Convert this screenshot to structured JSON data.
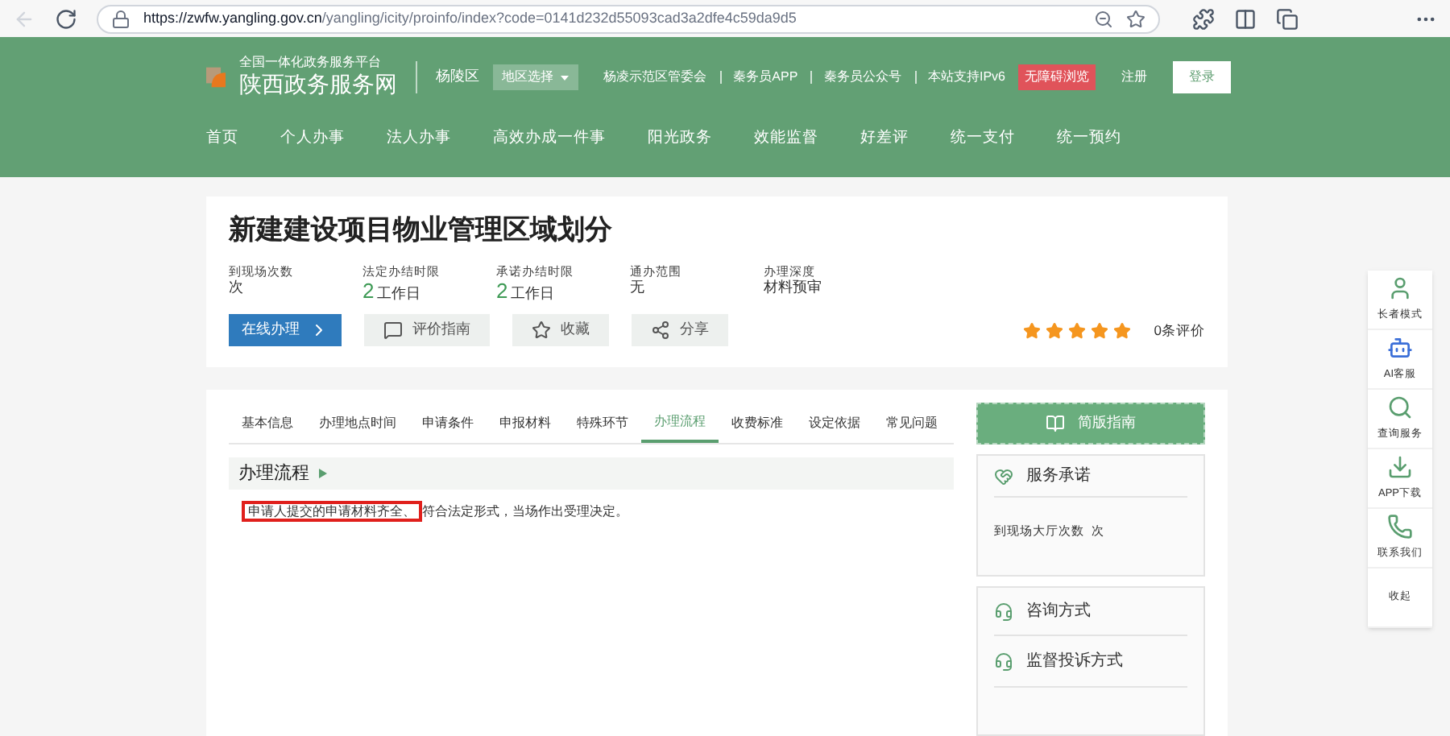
{
  "browser": {
    "url_host": "https://zwfw.yangling.gov.cn",
    "url_path": "/yangling/icity/proinfo/index?code=0141d232d55093cad3a2dfe4c59da9d5"
  },
  "header": {
    "logo_sub": "全国一体化政务服务平台",
    "logo_title": "陕西政务服务网",
    "region": "杨陵区",
    "region_select": "地区选择",
    "top_links": [
      "杨凌示范区管委会",
      "秦务员APP",
      "秦务员公众号",
      "本站支持IPv6"
    ],
    "accessibility": "无障碍浏览",
    "register": "注册",
    "login": "登录",
    "nav": [
      "首页",
      "个人办事",
      "法人办事",
      "高效办成一件事",
      "阳光政务",
      "效能监督",
      "好差评",
      "统一支付",
      "统一预约"
    ]
  },
  "service": {
    "title": "新建建设项目物业管理区域划分",
    "facts": [
      {
        "label": "到现场次数",
        "value": "次"
      },
      {
        "label": "法定办结时限",
        "number": "2",
        "value": "工作日"
      },
      {
        "label": "承诺办结时限",
        "number": "2",
        "value": "工作日"
      },
      {
        "label": "通办范围",
        "value": "无"
      },
      {
        "label": "办理深度",
        "value": "材料预审"
      }
    ],
    "buttons": [
      {
        "kind": "primary",
        "label": "在线办理"
      },
      {
        "kind": "guide",
        "label": "评价指南"
      },
      {
        "kind": "star",
        "label": "收藏"
      },
      {
        "kind": "share",
        "label": "分享"
      }
    ],
    "stars": 5,
    "reviews": "0条评价"
  },
  "tabs": [
    {
      "label": "基本信息",
      "selected": false
    },
    {
      "label": "办理地点时间",
      "selected": false
    },
    {
      "label": "申请条件",
      "selected": false
    },
    {
      "label": "申报材料",
      "selected": false
    },
    {
      "label": "特殊环节",
      "selected": false
    },
    {
      "label": "办理流程",
      "selected": true
    },
    {
      "label": "收费标准",
      "selected": false
    },
    {
      "label": "设定依据",
      "selected": false
    },
    {
      "label": "常见问题",
      "selected": false
    }
  ],
  "section": {
    "title": "办理流程",
    "highlighted": "申请人提交的申请材料齐全、",
    "text": "符合法定形式，当场作出受理决定。"
  },
  "side": {
    "guide_button": "简版指南",
    "promise_title": "服务承诺",
    "promise_text": "到现场大厅次数  次",
    "consult": "咨询方式",
    "complaint": "监督投诉方式"
  },
  "float_menu": [
    {
      "kind": "elder",
      "label": "长者模式"
    },
    {
      "kind": "ai",
      "label": "AI客服"
    },
    {
      "kind": "search",
      "label": "查询服务"
    },
    {
      "kind": "download",
      "label": "APP下载"
    },
    {
      "kind": "phone",
      "label": "联系我们"
    },
    {
      "kind": "text",
      "label": "收起"
    }
  ]
}
